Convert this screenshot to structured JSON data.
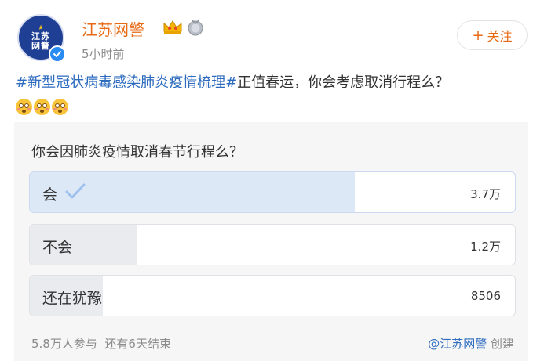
{
  "post": {
    "username": "江苏网警",
    "time": "5小时前",
    "avatar_text": "江苏\n网警",
    "icons": [
      "crown-icon",
      "medal-icon",
      "verified-icon"
    ],
    "follow_label": "关注",
    "follow_symbol": "+",
    "topic": "#新型冠状病毒感染肺炎疫情梳理#",
    "body": "正值春运，你会考虑取消行程么？",
    "emoji_count": 3,
    "emoji_name": "flushed-face-emoji"
  },
  "poll": {
    "question": "你会因肺炎疫情取消春节行程么？",
    "options": [
      {
        "label": "会",
        "count": "3.7万",
        "fraction": 0.67,
        "selected": true
      },
      {
        "label": "不会",
        "count": "1.2万",
        "fraction": 0.22,
        "selected": false
      },
      {
        "label": "还在犹豫",
        "count": "8506",
        "fraction": 0.15,
        "selected": false
      }
    ],
    "participants": "5.8万人参与",
    "remaining": "还有6天结束",
    "creator_handle": "@江苏网警",
    "creator_suffix": "创建"
  },
  "colors": {
    "username": "#e86a15",
    "topic": "#2d6bbf",
    "selected_fill": "#dde8f7",
    "unselected_fill": "#e9ebef",
    "check": "#9ec0ec"
  }
}
